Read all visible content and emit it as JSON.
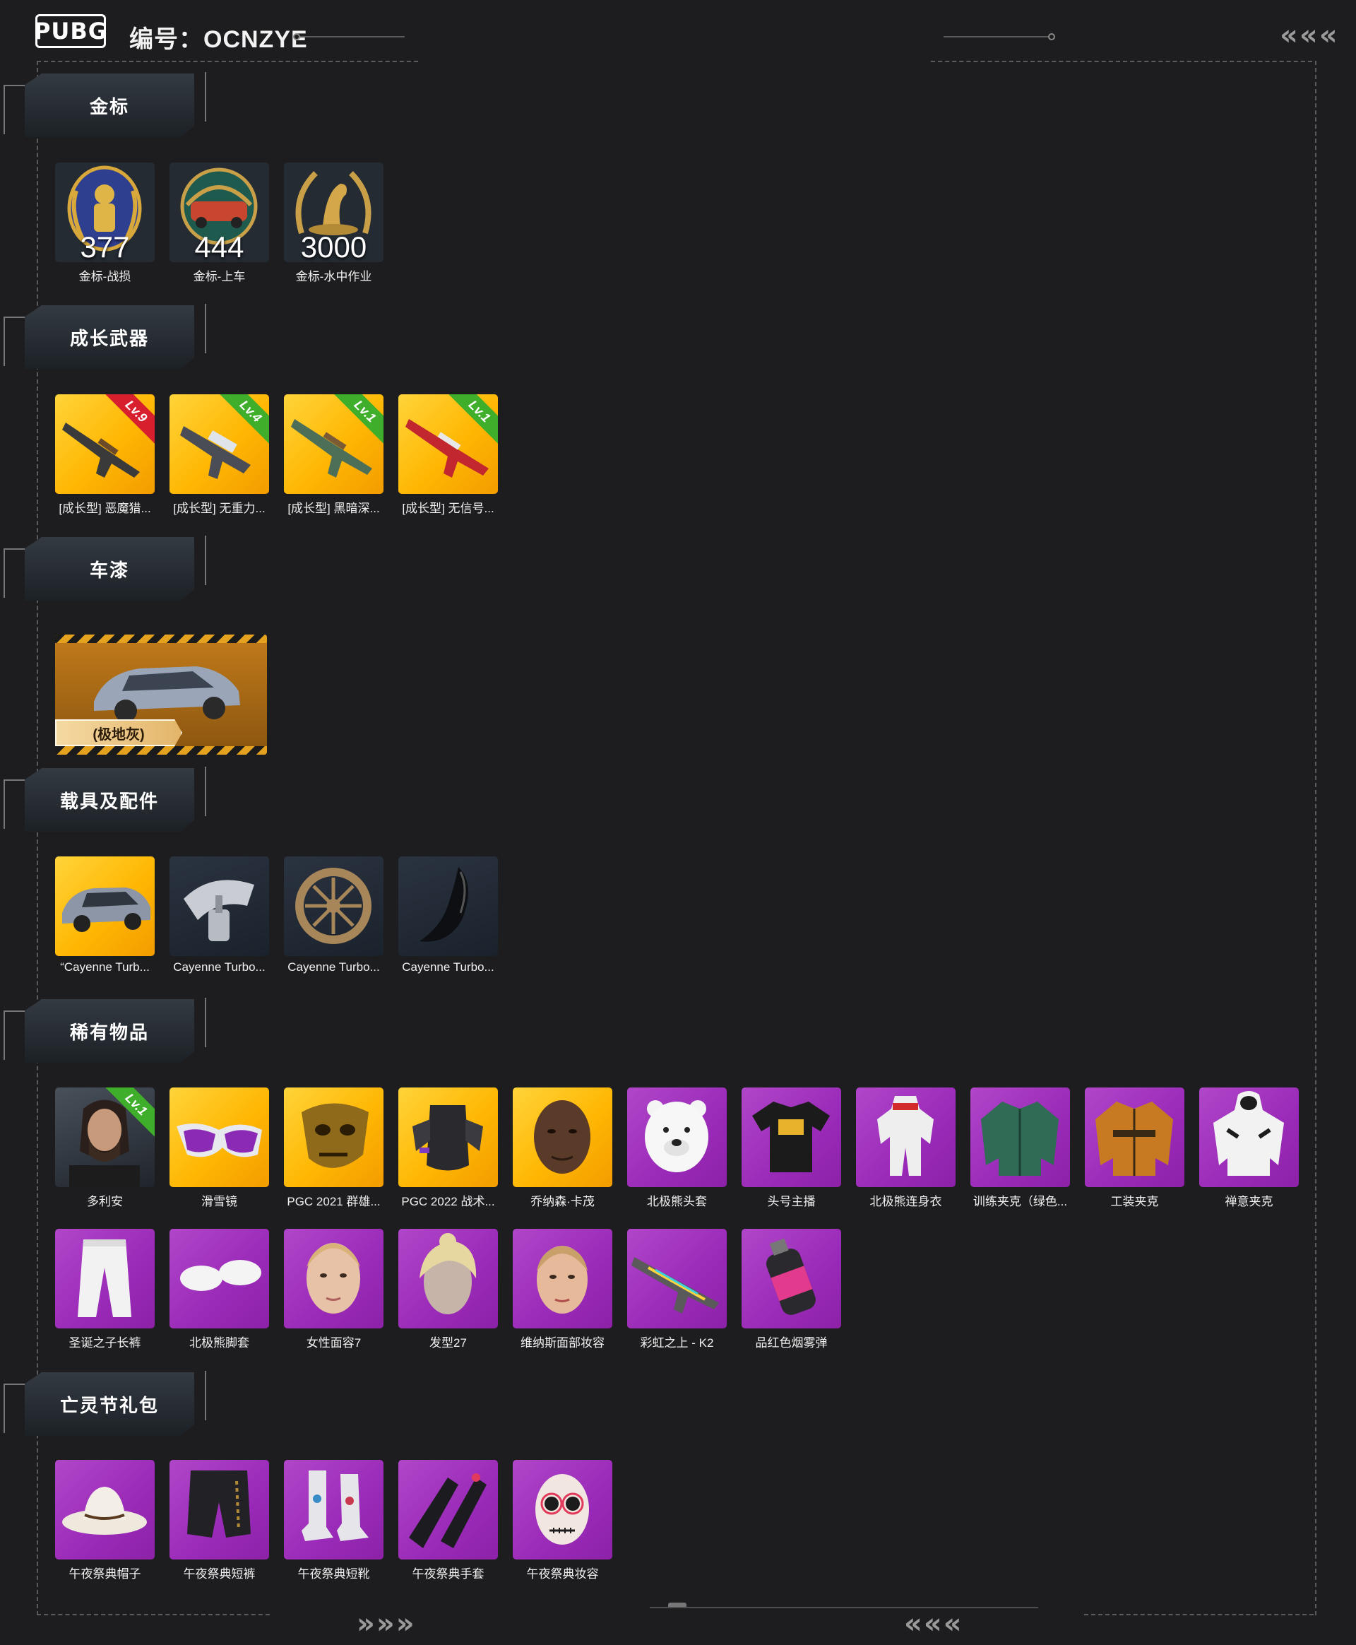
{
  "header": {
    "logo": "PUBG",
    "code_label": "编号：OCNZYE"
  },
  "colors": {
    "background": "#1d1d1f",
    "gold_tile": "#ffb703",
    "purple_tile": "#9a2ab8",
    "level_red": "#d81f2e",
    "level_green": "#3fae2a"
  },
  "sections": {
    "gold_badges": {
      "title": "金标",
      "items": [
        {
          "number": "377",
          "name": "金标-战损",
          "icon": "soldier-medal-icon"
        },
        {
          "number": "444",
          "name": "金标-上车",
          "icon": "car-medal-icon"
        },
        {
          "number": "3000",
          "name": "金标-水中作业",
          "icon": "seal-medal-icon"
        }
      ]
    },
    "growth_weapons": {
      "title": "成长武器",
      "items": [
        {
          "level": "Lv.9",
          "name": "[成长型] 恶魔猎...",
          "icon": "rifle-icon"
        },
        {
          "level": "Lv.4",
          "name": "[成长型] 无重力...",
          "icon": "smg-icon"
        },
        {
          "level": "Lv.1",
          "name": "[成长型] 黑暗深...",
          "icon": "rifle-icon"
        },
        {
          "level": "Lv.1",
          "name": "[成长型] 无信号...",
          "icon": "rifle-icon"
        }
      ]
    },
    "vehicle_paint": {
      "title": "车漆",
      "card_label": "(极地灰)"
    },
    "vehicle_parts": {
      "title": "载具及配件",
      "items": [
        {
          "name": "“Cayenne Turb...",
          "icon": "suv-icon"
        },
        {
          "name": "Cayenne Turbo...",
          "icon": "spray-gun-icon"
        },
        {
          "name": "Cayenne Turbo...",
          "icon": "wheel-icon"
        },
        {
          "name": "Cayenne Turbo...",
          "icon": "car-part-icon"
        }
      ]
    },
    "rare_items": {
      "title": "稀有物品",
      "row1": [
        {
          "name": "多利安",
          "level": "Lv.1",
          "icon": "character-portrait-icon"
        },
        {
          "name": "滑雪镜",
          "icon": "goggles-icon"
        },
        {
          "name": "PGC 2021 群雄...",
          "icon": "gold-mask-icon"
        },
        {
          "name": "PGC 2022 战术...",
          "icon": "tactical-vest-icon"
        },
        {
          "name": "乔纳森·卡茂",
          "icon": "face-icon"
        },
        {
          "name": "北极熊头套",
          "icon": "polar-bear-head-icon"
        },
        {
          "name": "头号主播",
          "icon": "tshirt-icon"
        },
        {
          "name": "北极熊连身衣",
          "icon": "onesie-icon"
        },
        {
          "name": "训练夹克（绿色...",
          "icon": "jacket-icon"
        },
        {
          "name": "工装夹克",
          "icon": "jacket-icon"
        },
        {
          "name": "禅意夹克",
          "icon": "hoodie-icon"
        }
      ],
      "row2": [
        {
          "name": "圣诞之子长裤",
          "icon": "pants-icon"
        },
        {
          "name": "北极熊脚套",
          "icon": "paws-icon"
        },
        {
          "name": "女性面容7",
          "icon": "face-icon"
        },
        {
          "name": "发型27",
          "icon": "hairstyle-icon"
        },
        {
          "name": "维纳斯面部妆容",
          "icon": "face-icon"
        },
        {
          "name": "彩虹之上 - K2",
          "icon": "rifle-icon"
        },
        {
          "name": "品红色烟雾弹",
          "icon": "smoke-grenade-icon"
        }
      ]
    },
    "undead_pack": {
      "title": "亡灵节礼包",
      "items": [
        {
          "name": "午夜祭典帽子",
          "icon": "hat-icon"
        },
        {
          "name": "午夜祭典短裤",
          "icon": "shorts-icon"
        },
        {
          "name": "午夜祭典短靴",
          "icon": "boots-icon"
        },
        {
          "name": "午夜祭典手套",
          "icon": "gloves-icon"
        },
        {
          "name": "午夜祭典妆容",
          "icon": "skull-face-icon"
        }
      ]
    }
  }
}
